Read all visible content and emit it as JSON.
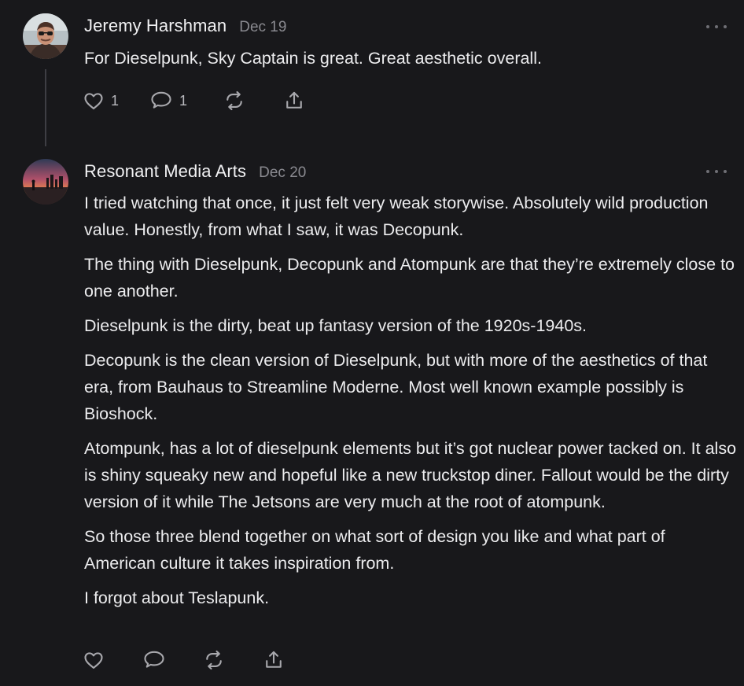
{
  "thread": {
    "posts": [
      {
        "author": "Jeremy Harshman",
        "date": "Dec 19",
        "avatar_icon": "person-portrait-avatar",
        "paragraphs": [
          "For Dieselpunk, Sky Captain is great. Great aesthetic overall."
        ],
        "actions": {
          "like_count": "1",
          "reply_count": "1"
        }
      },
      {
        "author": "Resonant Media Arts",
        "date": "Dec 20",
        "avatar_icon": "sunset-landscape-avatar",
        "paragraphs": [
          "I tried watching that once, it just felt very weak storywise. Absolutely wild production value. Honestly, from what I saw, it was Decopunk.",
          "The thing with Dieselpunk, Decopunk and Atompunk are that they’re extremely close to one another.",
          "Dieselpunk is the dirty, beat up fantasy version of the 1920s-1940s.",
          "Decopunk is the clean version of Dieselpunk, but with more of the aesthetics of that era, from Bauhaus to Streamline Moderne. Most well known example possibly is Bioshock.",
          "Atompunk, has a lot of dieselpunk elements but it’s got nuclear power tacked on. It also is shiny squeaky new and hopeful like a new truckstop diner. Fallout would be the dirty version of it while The Jetsons are very much at the root of atompunk.",
          "So those three blend together on what sort of design you like and what part of American culture it takes inspiration from.",
          "I forgot about Teslapunk."
        ],
        "actions": {
          "like_count": "",
          "reply_count": ""
        }
      }
    ]
  },
  "colors": {
    "background": "#18181b",
    "text": "#ececee",
    "muted": "#8a8a90",
    "icon": "#a8a8ad"
  }
}
